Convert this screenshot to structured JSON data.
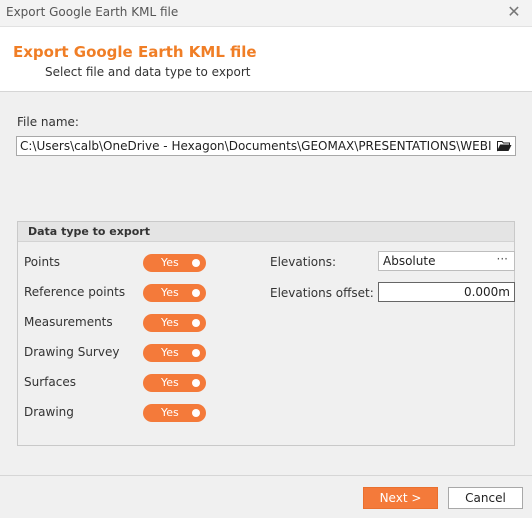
{
  "window": {
    "title": "Export Google Earth KML file"
  },
  "header": {
    "title": "Export Google Earth KML file",
    "subtitle": "Select file and data type to export"
  },
  "file": {
    "label": "File name:",
    "path": "C:\\Users\\calb\\OneDrive - Hexagon\\Documents\\GEOMAX\\PRESENTATIONS\\WEBINAR\\W"
  },
  "group": {
    "title": "Data type to export",
    "rows": [
      {
        "label": "Points",
        "toggle": "Yes"
      },
      {
        "label": "Reference points",
        "toggle": "Yes"
      },
      {
        "label": "Measurements",
        "toggle": "Yes"
      },
      {
        "label": "Drawing Survey",
        "toggle": "Yes"
      },
      {
        "label": "Surfaces",
        "toggle": "Yes"
      },
      {
        "label": "Drawing",
        "toggle": "Yes"
      }
    ],
    "elevations_label": "Elevations:",
    "elevations_value": "Absolute",
    "offset_label": "Elevations offset:",
    "offset_value": "0.000m"
  },
  "buttons": {
    "next": "Next >",
    "cancel": "Cancel"
  },
  "colors": {
    "accent": "#f47a3a",
    "title": "#f07e26"
  },
  "icons": {
    "close": "close-icon",
    "folder": "folder-open-icon",
    "dots": "ellipsis-icon"
  }
}
